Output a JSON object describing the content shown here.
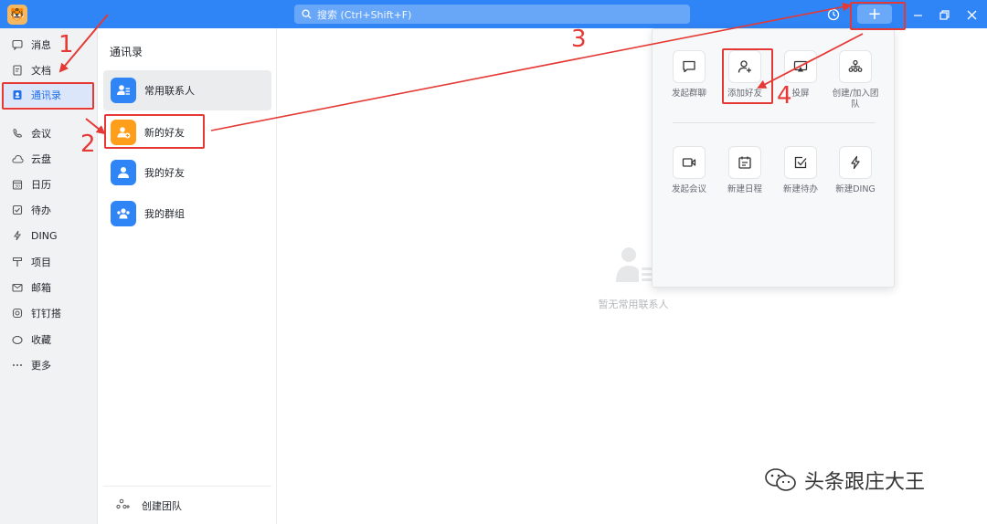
{
  "topbar": {
    "search_placeholder": "搜索 (Ctrl+Shift+F)",
    "plus_label": "+",
    "icons": [
      "avatar-logo",
      "search-icon",
      "history-icon",
      "minimize-icon",
      "restore-icon",
      "close-icon"
    ]
  },
  "nav": {
    "items": [
      {
        "label": "消息",
        "icon": "message-icon"
      },
      {
        "label": "文档",
        "icon": "document-icon"
      },
      {
        "label": "通讯录",
        "icon": "contacts-icon",
        "active": true
      },
      {
        "label": "会议",
        "icon": "meeting-icon"
      },
      {
        "label": "云盘",
        "icon": "cloud-icon"
      },
      {
        "label": "日历",
        "icon": "calendar-icon"
      },
      {
        "label": "待办",
        "icon": "todo-icon"
      },
      {
        "label": "DING",
        "icon": "ding-icon"
      },
      {
        "label": "项目",
        "icon": "project-icon"
      },
      {
        "label": "邮箱",
        "icon": "mail-icon"
      },
      {
        "label": "钉钉搭",
        "icon": "builder-icon"
      },
      {
        "label": "收藏",
        "icon": "favorite-icon"
      },
      {
        "label": "更多",
        "icon": "more-icon"
      }
    ]
  },
  "contacts": {
    "title": "通讯录",
    "items": [
      {
        "label": "常用联系人",
        "color": "#2f84f6",
        "active": true
      },
      {
        "label": "新的好友",
        "color": "#ff9e1b"
      },
      {
        "label": "我的好友",
        "color": "#2f84f6"
      },
      {
        "label": "我的群组",
        "color": "#2f84f6"
      }
    ],
    "footer_label": "创建团队"
  },
  "main": {
    "empty_text": "暂无常用联系人"
  },
  "dropdown": {
    "actions": [
      {
        "label": "发起群聊",
        "icon": "chat-bubble-icon"
      },
      {
        "label": "添加好友",
        "icon": "add-user-icon"
      },
      {
        "label": "投屏",
        "icon": "screen-cast-icon"
      },
      {
        "label": "创建/加入团队",
        "icon": "team-icon"
      },
      {
        "label": "发起会议",
        "icon": "video-icon"
      },
      {
        "label": "新建日程",
        "icon": "schedule-icon"
      },
      {
        "label": "新建待办",
        "icon": "checkbox-icon"
      },
      {
        "label": "新建DING",
        "icon": "lightning-icon"
      }
    ]
  },
  "annotations": {
    "numbers": [
      "1",
      "2",
      "3",
      "4"
    ],
    "color": "#e53935"
  },
  "watermark": {
    "text": "头条跟庄大王"
  },
  "colors": {
    "brand": "#2f84f6",
    "orange": "#ff9e1b",
    "nav_bg": "#f1f2f4"
  }
}
